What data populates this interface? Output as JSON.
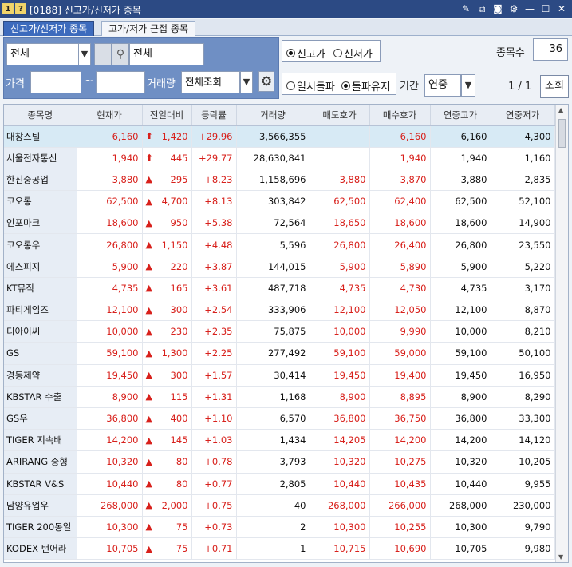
{
  "window": {
    "title": "[0188] 신고가/신저가 종목",
    "badge1": "1",
    "badge2": "?",
    "icons": [
      "memo-icon",
      "link-icon",
      "camera-icon",
      "gear-icon",
      "minimize-icon",
      "maximize-icon",
      "close-icon"
    ]
  },
  "tabs": [
    {
      "label": "신고가/신저가 종목",
      "active": true
    },
    {
      "label": "고가/저가 근접 종목",
      "active": false
    }
  ],
  "filter": {
    "market_select": "전체",
    "search_value": "전체",
    "price_label": "가격",
    "price_from": "",
    "tilde": "~",
    "price_to": "",
    "volume_label": "거래량",
    "volume_select": "전체조회"
  },
  "options": {
    "type_high": "신고가",
    "type_low": "신저가",
    "mode_temp": "일시돌파",
    "mode_keep": "돌파유지",
    "period_label": "기간",
    "period_select": "연중",
    "count_label": "종목수",
    "count_value": "36",
    "page": "1 / 1",
    "view_button": "조회"
  },
  "table": {
    "headers": [
      "종목명",
      "현재가",
      "전일대비",
      "등락률",
      "거래량",
      "매도호가",
      "매수호가",
      "연중고가",
      "연중저가"
    ],
    "rows": [
      {
        "name": "대창스틸",
        "price": "6,160",
        "arrow": "⬆",
        "change": "1,420",
        "rate": "+29.96",
        "volume": "3,566,355",
        "ask": "",
        "bid": "6,160",
        "high": "6,160",
        "low": "4,300"
      },
      {
        "name": "서울전자통신",
        "price": "1,940",
        "arrow": "⬆",
        "change": "445",
        "rate": "+29.77",
        "volume": "28,630,841",
        "ask": "",
        "bid": "1,940",
        "high": "1,940",
        "low": "1,160"
      },
      {
        "name": "한진중공업",
        "price": "3,880",
        "arrow": "▲",
        "change": "295",
        "rate": "+8.23",
        "volume": "1,158,696",
        "ask": "3,880",
        "bid": "3,870",
        "high": "3,880",
        "low": "2,835"
      },
      {
        "name": "코오롱",
        "price": "62,500",
        "arrow": "▲",
        "change": "4,700",
        "rate": "+8.13",
        "volume": "303,842",
        "ask": "62,500",
        "bid": "62,400",
        "high": "62,500",
        "low": "52,100"
      },
      {
        "name": "인포마크",
        "price": "18,600",
        "arrow": "▲",
        "change": "950",
        "rate": "+5.38",
        "volume": "72,564",
        "ask": "18,650",
        "bid": "18,600",
        "high": "18,600",
        "low": "14,900"
      },
      {
        "name": "코오롱우",
        "price": "26,800",
        "arrow": "▲",
        "change": "1,150",
        "rate": "+4.48",
        "volume": "5,596",
        "ask": "26,800",
        "bid": "26,400",
        "high": "26,800",
        "low": "23,550"
      },
      {
        "name": "에스피지",
        "price": "5,900",
        "arrow": "▲",
        "change": "220",
        "rate": "+3.87",
        "volume": "144,015",
        "ask": "5,900",
        "bid": "5,890",
        "high": "5,900",
        "low": "5,220"
      },
      {
        "name": "KT뮤직",
        "price": "4,735",
        "arrow": "▲",
        "change": "165",
        "rate": "+3.61",
        "volume": "487,718",
        "ask": "4,735",
        "bid": "4,730",
        "high": "4,735",
        "low": "3,170"
      },
      {
        "name": "파티게임즈",
        "price": "12,100",
        "arrow": "▲",
        "change": "300",
        "rate": "+2.54",
        "volume": "333,906",
        "ask": "12,100",
        "bid": "12,050",
        "high": "12,100",
        "low": "8,870"
      },
      {
        "name": "디아이씨",
        "price": "10,000",
        "arrow": "▲",
        "change": "230",
        "rate": "+2.35",
        "volume": "75,875",
        "ask": "10,000",
        "bid": "9,990",
        "high": "10,000",
        "low": "8,210"
      },
      {
        "name": "GS",
        "price": "59,100",
        "arrow": "▲",
        "change": "1,300",
        "rate": "+2.25",
        "volume": "277,492",
        "ask": "59,100",
        "bid": "59,000",
        "high": "59,100",
        "low": "50,100"
      },
      {
        "name": "경동제약",
        "price": "19,450",
        "arrow": "▲",
        "change": "300",
        "rate": "+1.57",
        "volume": "30,414",
        "ask": "19,450",
        "bid": "19,400",
        "high": "19,450",
        "low": "16,950"
      },
      {
        "name": "KBSTAR 수출",
        "price": "8,900",
        "arrow": "▲",
        "change": "115",
        "rate": "+1.31",
        "volume": "1,168",
        "ask": "8,900",
        "bid": "8,895",
        "high": "8,900",
        "low": "8,290"
      },
      {
        "name": "GS우",
        "price": "36,800",
        "arrow": "▲",
        "change": "400",
        "rate": "+1.10",
        "volume": "6,570",
        "ask": "36,800",
        "bid": "36,750",
        "high": "36,800",
        "low": "33,300"
      },
      {
        "name": "TIGER 지속배",
        "price": "14,200",
        "arrow": "▲",
        "change": "145",
        "rate": "+1.03",
        "volume": "1,434",
        "ask": "14,205",
        "bid": "14,200",
        "high": "14,200",
        "low": "14,120"
      },
      {
        "name": "ARIRANG 중형",
        "price": "10,320",
        "arrow": "▲",
        "change": "80",
        "rate": "+0.78",
        "volume": "3,793",
        "ask": "10,320",
        "bid": "10,275",
        "high": "10,320",
        "low": "10,205"
      },
      {
        "name": "KBSTAR V&S",
        "price": "10,440",
        "arrow": "▲",
        "change": "80",
        "rate": "+0.77",
        "volume": "2,805",
        "ask": "10,440",
        "bid": "10,435",
        "high": "10,440",
        "low": "9,955"
      },
      {
        "name": "남양유업우",
        "price": "268,000",
        "arrow": "▲",
        "change": "2,000",
        "rate": "+0.75",
        "volume": "40",
        "ask": "268,000",
        "bid": "266,000",
        "high": "268,000",
        "low": "230,000"
      },
      {
        "name": "TIGER 200동일",
        "price": "10,300",
        "arrow": "▲",
        "change": "75",
        "rate": "+0.73",
        "volume": "2",
        "ask": "10,300",
        "bid": "10,255",
        "high": "10,300",
        "low": "9,790"
      },
      {
        "name": "KODEX 턴어라",
        "price": "10,705",
        "arrow": "▲",
        "change": "75",
        "rate": "+0.71",
        "volume": "1",
        "ask": "10,715",
        "bid": "10,690",
        "high": "10,705",
        "low": "9,980"
      }
    ]
  },
  "colors": {
    "titlebar": "#2c4a84",
    "up": "#d8201b",
    "panel": "#6f8fc4",
    "selected_row": "#d7eaf5"
  }
}
